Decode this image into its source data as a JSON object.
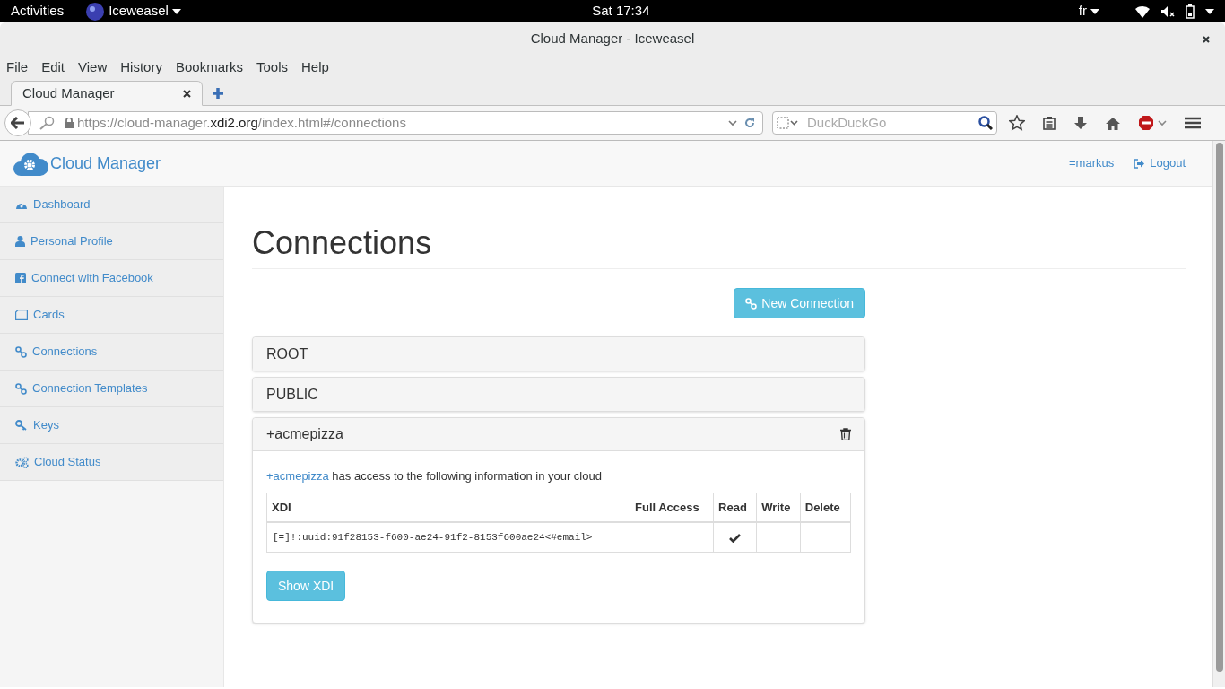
{
  "top_bar": {
    "activities": "Activities",
    "app_menu": "Iceweasel",
    "clock": "Sat 17:34",
    "language": "fr"
  },
  "window": {
    "title": "Cloud Manager - Iceweasel"
  },
  "menu": [
    "File",
    "Edit",
    "View",
    "History",
    "Bookmarks",
    "Tools",
    "Help"
  ],
  "tabs": [
    {
      "label": "Cloud Manager",
      "selected": true
    }
  ],
  "address_bar": {
    "scheme_host": "https://cloud-manager.",
    "domain": "xdi2.org",
    "path": "/index.html#/connections"
  },
  "search": {
    "placeholder": "DuckDuckGo"
  },
  "site": {
    "brand": "Cloud Manager",
    "user": "=markus",
    "logout": "Logout"
  },
  "sidebar": {
    "items": [
      {
        "label": "Dashboard"
      },
      {
        "label": "Personal Profile"
      },
      {
        "label": "Connect with Facebook"
      },
      {
        "label": "Cards"
      },
      {
        "label": "Connections"
      },
      {
        "label": "Connection Templates"
      },
      {
        "label": "Keys"
      },
      {
        "label": "Cloud Status"
      }
    ]
  },
  "page": {
    "title": "Connections",
    "new_button": "New Connection"
  },
  "panels": [
    {
      "title": "ROOT",
      "expanded": false
    },
    {
      "title": "PUBLIC",
      "expanded": false
    },
    {
      "title": "+acmepizza",
      "expanded": true,
      "body": {
        "link": "+acmepizza",
        "text": "has access to the following information in your cloud",
        "columns": [
          "XDI",
          "Full Access",
          "Read",
          "Write",
          "Delete"
        ],
        "rows": [
          {
            "xdi": "[=]!:uuid:91f28153-f600-ae24-91f2-8153f600ae24<#email>",
            "full_access": false,
            "read": true,
            "write": false,
            "delete": false
          }
        ],
        "button": "Show XDI"
      }
    }
  ]
}
